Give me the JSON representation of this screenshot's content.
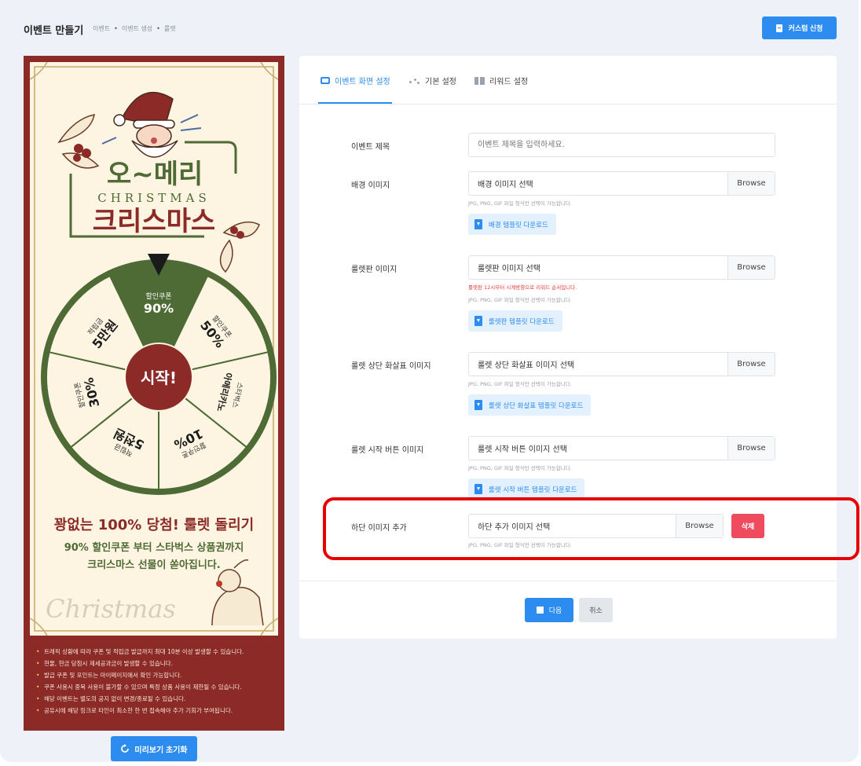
{
  "header": {
    "title": "이벤트 만들기",
    "breadcrumb": [
      "이벤트",
      "이벤트 생성",
      "룰렛"
    ],
    "custom_button": "커스텀 신청"
  },
  "preview": {
    "poster": {
      "title_main": "오~메리",
      "title_christmas": "CHRISTMAS",
      "title_sub": "크리스마스",
      "wheel_segments": [
        {
          "line1": "할인쿠폰",
          "line2": "90%"
        },
        {
          "line1": "할인쿠폰",
          "line2": "50%"
        },
        {
          "line1": "스타벅스",
          "line2": "아메리카노"
        },
        {
          "line1": "할인쿠폰",
          "line2": "10%"
        },
        {
          "line1": "적립금",
          "line2": "5천원"
        },
        {
          "line1": "할인쿠폰",
          "line2": "30%"
        },
        {
          "line1": "적립금",
          "line2": "5만원"
        }
      ],
      "start_label": "시작!",
      "headline": "꽝없는 100% 당첨! 룰렛 돌리기",
      "subline1": "90% 할인쿠폰 부터 스타벅스 상품권까지",
      "subline2": "크리스마스 선물이 쏟아집니다.",
      "script_word": "Christmas"
    },
    "notices": [
      "트래픽 상황에 따라 쿠폰 및 적립금 발급까지 최대 10분 이상 발생할 수 있습니다.",
      "현물, 현금 당첨시 제세공과금이 발생할 수 있습니다.",
      "발급 쿠폰 및 포인트는 마이페이지에서 확인 가능합니다.",
      "쿠폰 사용시 중복 사용이 불가할 수 있으며 특정 상품 사용이 제한될 수 있습니다.",
      "해당 이벤트는 별도의 공지 없이 변경/종료될 수 있습니다.",
      "공유시에 해당 링크로 타인이 최소한 한 번 접속해야 추가 기회가 부여됩니다."
    ],
    "reset_button": "미리보기 초기화"
  },
  "tabs": [
    {
      "label": "이벤트 화면 설정",
      "icon": "monitor-icon",
      "active": true
    },
    {
      "label": "기본 설정",
      "icon": "dots-icon",
      "active": false
    },
    {
      "label": "리워드 설정",
      "icon": "gift-icon",
      "active": false
    }
  ],
  "form": {
    "title": {
      "label": "이벤트 제목",
      "placeholder": "이벤트 제목을 입력하세요."
    },
    "background": {
      "label": "배경 이미지",
      "value": "배경 이미지 선택",
      "browse": "Browse",
      "hint": "JPG, PNG, GIF 파일 형식만 선택이 가능합니다.",
      "template": "배경 템플릿 다운로드"
    },
    "roulette": {
      "label": "룰렛판 이미지",
      "value": "룰렛판 이미지 선택",
      "browse": "Browse",
      "warning": "룰렛판 12시부터 시계방향으로 리워드 순서입니다.",
      "hint": "JPG, PNG, GIF 파일 형식만 선택이 가능합니다.",
      "template": "룰렛판 템플릿 다운로드"
    },
    "arrow": {
      "label": "룰렛 상단 화살표 이미지",
      "value": "룰렛 상단 화살표 이미지 선택",
      "browse": "Browse",
      "hint": "JPG, PNG, GIF 파일 형식만 선택이 가능합니다.",
      "template": "룰렛 상단 화살표 템플릿 다운로드"
    },
    "start": {
      "label": "룰렛 시작 버튼 이미지",
      "value": "룰렛 시작 버튼 이미지 선택",
      "browse": "Browse",
      "hint": "JPG, PNG, GIF 파일 형식만 선택이 가능합니다.",
      "template": "룰렛 시작 버튼 템플릿 다운로드"
    },
    "bottom": {
      "label": "하단 이미지 추가",
      "value": "하단 추가 이미지 선택",
      "browse": "Browse",
      "hint": "JPG, PNG, GIF 파일 형식만 선택이 가능합니다.",
      "delete": "삭제"
    }
  },
  "actions": {
    "next": "다음",
    "cancel": "취소"
  },
  "colors": {
    "accent": "#2d8cf0",
    "danger": "#ef4b5f",
    "poster_red": "#8b2a27",
    "poster_green": "#4e6a35",
    "highlight": "#e60000"
  }
}
